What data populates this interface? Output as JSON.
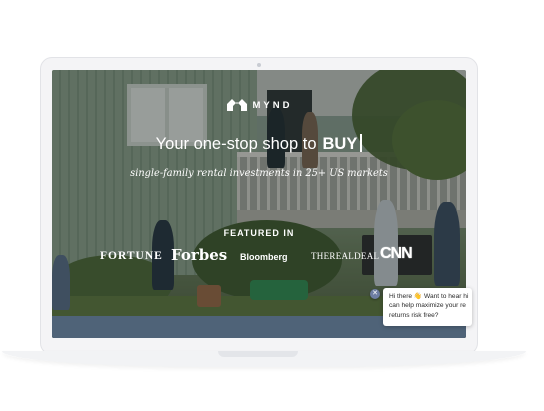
{
  "brand": {
    "logo_icon": "house-logo-icon",
    "name": "MYND"
  },
  "hero": {
    "headline_prefix": "Your one-stop shop to",
    "headline_emphasis": "BUY",
    "subheadline": "single-family rental investments in 25+ US markets"
  },
  "press": {
    "heading": "FEATURED IN",
    "logos": [
      "FORTUNE",
      "Forbes",
      "Bloomberg",
      "THEREALDEAL",
      "CNN"
    ]
  },
  "chat": {
    "close_icon": "close-icon",
    "message_lines": [
      "Hi there 👋 Want to hear hi",
      "can help maximize your re",
      "returns risk free?"
    ]
  },
  "colors": {
    "footer_bar": "#4f6378",
    "chat_close": "#6e7ea3",
    "text_on_hero": "#ffffff"
  }
}
